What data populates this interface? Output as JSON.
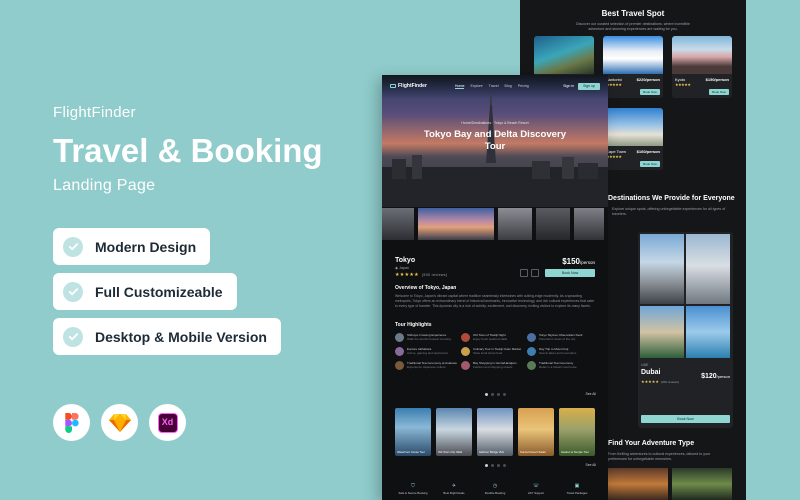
{
  "promo": {
    "brand": "FlightFinder",
    "headline": "Travel & Booking",
    "subhead": "Landing Page",
    "features": [
      "Modern Design",
      "Full Customizeable",
      "Desktop & Mobile Version"
    ],
    "tools": [
      "figma-icon",
      "sketch-icon",
      "xd-icon"
    ],
    "xd_label": "Xd"
  },
  "colors": {
    "background": "#8fcccb",
    "screen": "#0f1012",
    "accent": "#8fd6d2",
    "star": "#f2c94c"
  },
  "front": {
    "nav": {
      "logo": "FlightFinder",
      "links": [
        "Home",
        "Explore",
        "Travel",
        "Blog",
        "Pricing"
      ],
      "signin": "Sign in",
      "signup": "Sign up"
    },
    "hero": {
      "kicker": "Home/Destinations · Tokyo & Beach Resort",
      "title": "Tokyo Bay and Delta Discovery Tour"
    },
    "destination": {
      "name": "Tokyo",
      "location": "Japan",
      "stars": "★★★★★",
      "reviews": "(500 reviews)",
      "price": "$150",
      "per": "/person",
      "book": "Book Now"
    },
    "overview": {
      "title": "Overview of Tokyo, Japan",
      "text": "Welcome to Tokyo, Japan's vibrant capital where tradition seamlessly intertwines with cutting-edge modernity. As a sprawling metropolis, Tokyo offers an extraordinary blend of historical landmarks, innovative technology, and rich cultural experiences that cater to every type of traveler. This dynamic city is a hub of activity, excitement, and discovery, inviting visitors to explore its many facets."
    },
    "highlights": {
      "title": "Tour Highlights",
      "items": [
        {
          "name": "Shibuya Crossing Experience",
          "sub": "Walk the world's busiest crossing"
        },
        {
          "name": "Old Town of Tsukiji Night",
          "sub": "Enjoy fresh seafood stalls"
        },
        {
          "name": "Tokyo Skytree Observation Deck",
          "sub": "Panoramic views of the city"
        },
        {
          "name": "Explore Akihabara",
          "sub": "Anime, gaming and electronics"
        },
        {
          "name": "Culinary Tour in Tsukiji Outer Market",
          "sub": "Taste local street food"
        },
        {
          "name": "Day Trip to Mount Fuji",
          "sub": "Scenic lakes and mountains"
        },
        {
          "name": "Traditional Tea Ceremony at Asakusa",
          "sub": "Experience Japanese culture"
        },
        {
          "name": "Bay Shopping in Ginza/Harajuku",
          "sub": "Fashion and shopping streets"
        },
        {
          "name": "Traditional Tea Ceremony",
          "sub": "Relax in a historic tea house"
        }
      ]
    },
    "see_all": "See All",
    "cards": [
      {
        "caption": "Waterfront Cruise Tour"
      },
      {
        "caption": "Old Town City Walk"
      },
      {
        "caption": "Harbour Bridge Visit"
      },
      {
        "caption": "Sunset Desert Safari"
      },
      {
        "caption": "Garden & Temple Tour"
      }
    ],
    "features": [
      {
        "icon": "shield-icon",
        "label": "Safe & Secure Booking"
      },
      {
        "icon": "plane-icon",
        "label": "Best Flight Deals"
      },
      {
        "icon": "clock-icon",
        "label": "Flexible Booking"
      },
      {
        "icon": "phone-icon",
        "label": "24/7 Support"
      },
      {
        "icon": "bag-icon",
        "label": "Travel Packages"
      },
      {
        "icon": "star-icon",
        "label": "Trusted Reviews"
      }
    ]
  },
  "back": {
    "title": "Best Travel Spot",
    "desc": "Discover our curated selection of premier destinations, where incredible adventure and stunning experiences are waiting for you.",
    "spots": [
      {
        "name": "Bali",
        "price": "$180/person",
        "stars": "★★★★★",
        "book": "Book Now"
      },
      {
        "name": "Santorini",
        "price": "$220/person",
        "stars": "★★★★★",
        "book": "Book Now"
      },
      {
        "name": "Kyoto",
        "price": "$150/person",
        "stars": "★★★★★",
        "book": "Book Now"
      },
      {
        "name": "New York City",
        "price": "$190/person",
        "stars": "★★★★★",
        "book": "Book Now"
      },
      {
        "name": "Cape Town",
        "price": "$160/person",
        "stars": "★★★★★",
        "book": "Book Now"
      }
    ],
    "section2": "Destinations We Provide for Everyone",
    "section2_desc": "Explore unique spots, offering unforgettable experiences for all types of travelers.",
    "dubai": {
      "country": "UAE",
      "name": "Dubai",
      "price": "$120",
      "per": "/person",
      "stars": "★★★★★",
      "reviews": "(300 reviews)",
      "book": "Book Now"
    },
    "section3": "Find Your Adventure Type",
    "section3_desc": "From thrilling adventures to cultural experiences, tailored to your preferences for unforgettable memories."
  }
}
